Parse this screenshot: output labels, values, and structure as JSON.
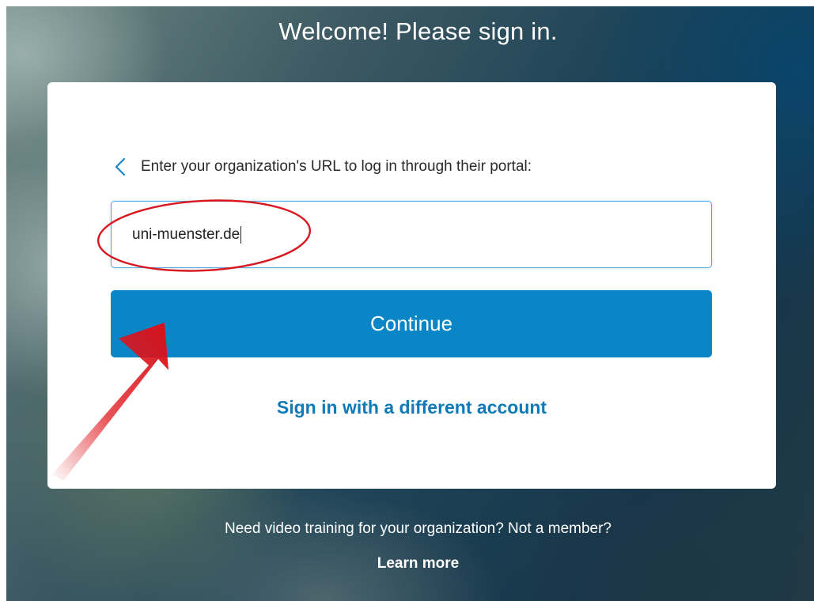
{
  "page": {
    "title": "Welcome! Please sign in."
  },
  "card": {
    "instruction": "Enter your organization's URL to log in through their portal:",
    "back_icon": "chevron-left-icon",
    "url_field": {
      "value": "uni-muenster.de"
    },
    "continue_label": "Continue",
    "alt_signin_label": "Sign in with a different account"
  },
  "footer": {
    "text": "Need video training for your organization? Not a member?",
    "learn_more_label": "Learn more"
  },
  "annotations": {
    "highlight_ellipse_color": "#d8161e",
    "arrow_color": "#e0161c"
  },
  "colors": {
    "accent": "#0a86c7",
    "link": "#0e7ab8",
    "input_border": "#5aa7d8"
  }
}
